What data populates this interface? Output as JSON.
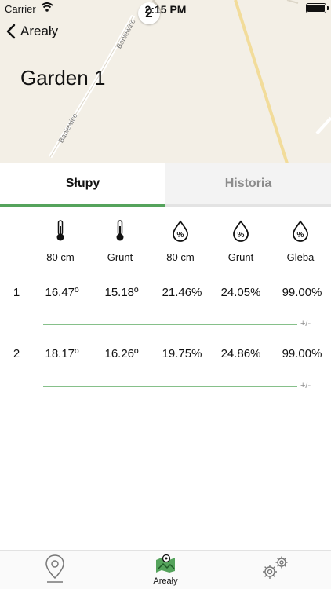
{
  "status": {
    "carrier": "Carrier",
    "time": "2:15 PM",
    "map_badge": "2"
  },
  "nav": {
    "back_label": "Areały"
  },
  "map": {
    "title": "Garden 1",
    "road_labels": [
      "Baniewice",
      "Baniewice"
    ]
  },
  "tabs": [
    {
      "label": "Słupy",
      "selected": true
    },
    {
      "label": "Historia",
      "selected": false
    }
  ],
  "sensors": [
    {
      "icon": "thermometer-icon",
      "label": "80 cm"
    },
    {
      "icon": "thermometer-icon",
      "label": "Grunt"
    },
    {
      "icon": "humidity-drop-icon",
      "label": "80 cm"
    },
    {
      "icon": "humidity-drop-icon",
      "label": "Grunt"
    },
    {
      "icon": "humidity-drop-icon",
      "label": "Gleba"
    }
  ],
  "rows": [
    {
      "index": "1",
      "values": [
        "16.47º",
        "15.18º",
        "21.46%",
        "24.05%",
        "99.00%"
      ],
      "tolerance": "+/-"
    },
    {
      "index": "2",
      "values": [
        "18.17º",
        "16.26º",
        "19.75%",
        "24.86%",
        "99.00%"
      ],
      "tolerance": "+/-"
    }
  ],
  "bottom_tabs": [
    {
      "icon": "map-pin-icon",
      "label": ""
    },
    {
      "icon": "map-area-icon",
      "label": "Areały"
    },
    {
      "icon": "gears-icon",
      "label": ""
    }
  ],
  "colors": {
    "accent": "#55a35c",
    "divider": "#86c08a",
    "map_bg": "#f3efe6"
  }
}
